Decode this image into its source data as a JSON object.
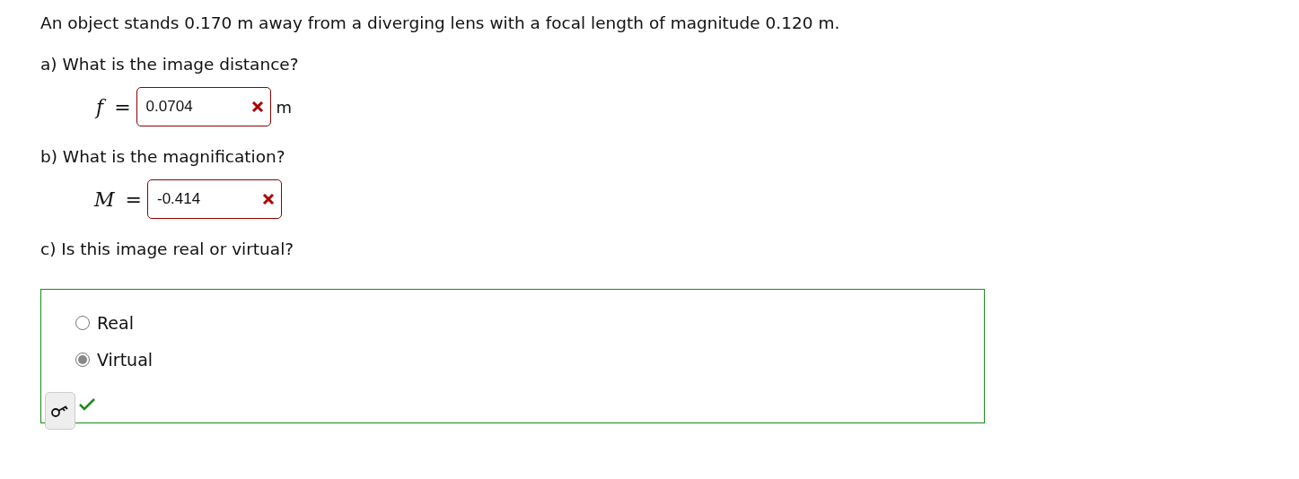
{
  "problem": "An object stands 0.170 m away from a diverging lens with a focal length of magnitude 0.120 m.",
  "parts": [
    {
      "kind": "numeric",
      "prompt": "a) What is the image distance?",
      "variable": "f",
      "relation": "=",
      "value": "0.0704",
      "correct": false,
      "unit": "m"
    },
    {
      "kind": "numeric",
      "prompt": "b) What is the magnification?",
      "variable": "M",
      "relation": "=",
      "value": "-0.414",
      "correct": false
    },
    {
      "kind": "choice",
      "prompt": "c) Is this image real or virtual?",
      "options": [
        {
          "label": "Real",
          "selected": false
        },
        {
          "label": "Virtual",
          "selected": true
        }
      ],
      "correct": true
    }
  ]
}
